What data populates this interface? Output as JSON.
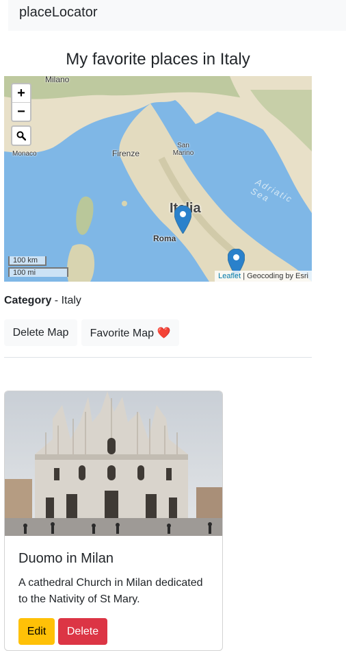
{
  "navbar": {
    "brand": "placeLocator"
  },
  "page": {
    "title": "My favorite places in Italy"
  },
  "map": {
    "zoom_in": "+",
    "zoom_out": "−",
    "search_icon": "search-icon",
    "scale_km": "100 km",
    "scale_mi": "100 mi",
    "attribution_link": "Leaflet",
    "attribution_text": " | Geocoding by Esri",
    "labels": {
      "milano": "Milano",
      "monaco": "Monaco",
      "firenze": "Firenze",
      "san_marino": "San Marino",
      "italia": "Italia",
      "roma": "Roma",
      "adriatic": "Adriatic Sea"
    },
    "marker_color": "#2a81cb"
  },
  "category": {
    "label": "Category",
    "separator": " - ",
    "value": "Italy"
  },
  "actions": {
    "delete_map": "Delete Map",
    "favorite_map": "Favorite Map",
    "favorite_icon": "❤️"
  },
  "places": [
    {
      "title": "Duomo in Milan",
      "description": "A cathedral Church in Milan dedicated to the Nativity of St Mary.",
      "edit_label": "Edit",
      "delete_label": "Delete"
    }
  ],
  "colors": {
    "edit": "#ffc107",
    "delete": "#dc3545",
    "light": "#f8f9fa"
  }
}
